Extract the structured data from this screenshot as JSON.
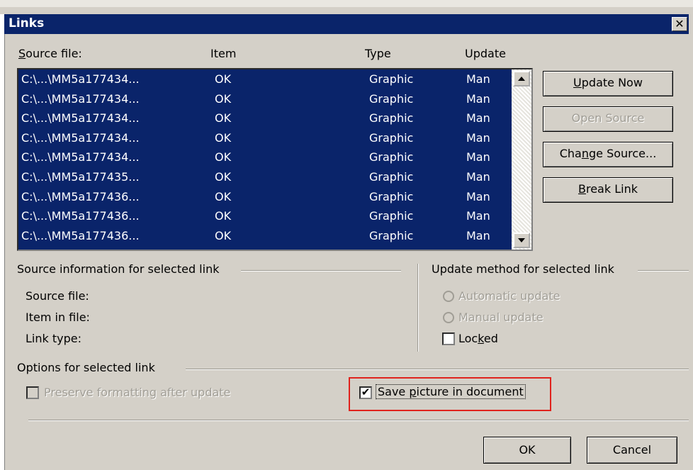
{
  "dialog": {
    "title": "Links",
    "close_glyph": "✕"
  },
  "columns": {
    "source": "Source file:",
    "item": "Item",
    "type": "Type",
    "update": "Update"
  },
  "links": [
    {
      "source": "C:\\...\\MM5a177434...",
      "item": "OK",
      "type": "Graphic",
      "update": "Man"
    },
    {
      "source": "C:\\...\\MM5a177434...",
      "item": "OK",
      "type": "Graphic",
      "update": "Man"
    },
    {
      "source": "C:\\...\\MM5a177434...",
      "item": "OK",
      "type": "Graphic",
      "update": "Man"
    },
    {
      "source": "C:\\...\\MM5a177434...",
      "item": "OK",
      "type": "Graphic",
      "update": "Man"
    },
    {
      "source": "C:\\...\\MM5a177434...",
      "item": "OK",
      "type": "Graphic",
      "update": "Man"
    },
    {
      "source": "C:\\...\\MM5a177435...",
      "item": "OK",
      "type": "Graphic",
      "update": "Man"
    },
    {
      "source": "C:\\...\\MM5a177436...",
      "item": "OK",
      "type": "Graphic",
      "update": "Man"
    },
    {
      "source": "C:\\...\\MM5a177436...",
      "item": "OK",
      "type": "Graphic",
      "update": "Man"
    },
    {
      "source": "C:\\...\\MM5a177436...",
      "item": "OK",
      "type": "Graphic",
      "update": "Man"
    }
  ],
  "buttons": {
    "update_now": "Update Now",
    "open_source": "Open Source",
    "change_source": "Change Source...",
    "break_link": "Break Link",
    "ok": "OK",
    "cancel": "Cancel"
  },
  "source_info": {
    "title": "Source information for selected link",
    "source_file": "Source file:",
    "item_in_file": "Item in file:",
    "link_type": "Link type:"
  },
  "update_method": {
    "title": "Update method for selected link",
    "automatic": "Automatic update",
    "manual": "Manual update",
    "locked": "Locked",
    "locked_checked": false
  },
  "options": {
    "title": "Options for selected link",
    "preserve_formatting": "Preserve formatting after update",
    "preserve_checked": false,
    "save_picture": "Save picture in document",
    "save_picture_checked": true
  },
  "colors": {
    "selection": "#0a246a",
    "highlight_box": "#e0231d",
    "dialog_bg": "#d4d0c8"
  }
}
